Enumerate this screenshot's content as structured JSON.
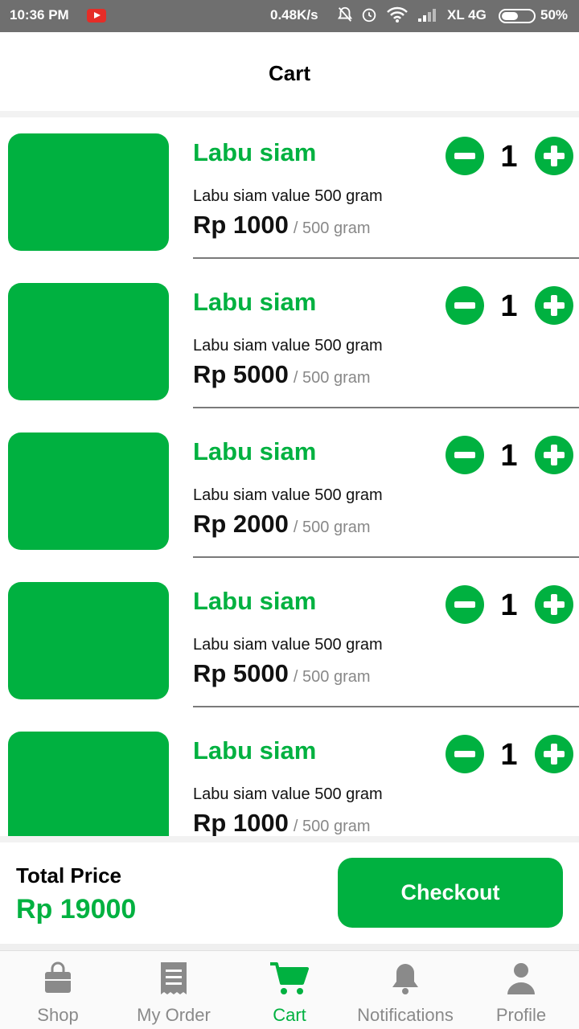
{
  "status_bar": {
    "time": "10:36 PM",
    "speed": "0.48K/s",
    "carrier": "XL 4G",
    "battery": "50%"
  },
  "header": {
    "title": "Cart"
  },
  "colors": {
    "accent": "#00b140",
    "muted": "#8a8a8a"
  },
  "cart": {
    "items": [
      {
        "name": "Labu siam",
        "description": "Labu siam value 500 gram",
        "price": "Rp 1000",
        "unit": "/ 500 gram",
        "qty": "1"
      },
      {
        "name": "Labu siam",
        "description": "Labu siam value 500 gram",
        "price": "Rp 5000",
        "unit": "/ 500 gram",
        "qty": "1"
      },
      {
        "name": "Labu siam",
        "description": "Labu siam value 500 gram",
        "price": "Rp 2000",
        "unit": "/ 500 gram",
        "qty": "1"
      },
      {
        "name": "Labu siam",
        "description": "Labu siam value 500 gram",
        "price": "Rp 5000",
        "unit": "/ 500 gram",
        "qty": "1"
      },
      {
        "name": "Labu siam",
        "description": "Labu siam value 500 gram",
        "price": "Rp 1000",
        "unit": "/ 500 gram",
        "qty": "1"
      }
    ]
  },
  "total": {
    "label": "Total Price",
    "value": "Rp 19000",
    "checkout_label": "Checkout"
  },
  "nav": {
    "items": [
      {
        "label": "Shop",
        "icon": "shopping-bag-icon"
      },
      {
        "label": "My Order",
        "icon": "receipt-icon"
      },
      {
        "label": "Cart",
        "icon": "cart-icon",
        "active": true
      },
      {
        "label": "Notifications",
        "icon": "bell-icon"
      },
      {
        "label": "Profile",
        "icon": "person-icon"
      }
    ]
  }
}
